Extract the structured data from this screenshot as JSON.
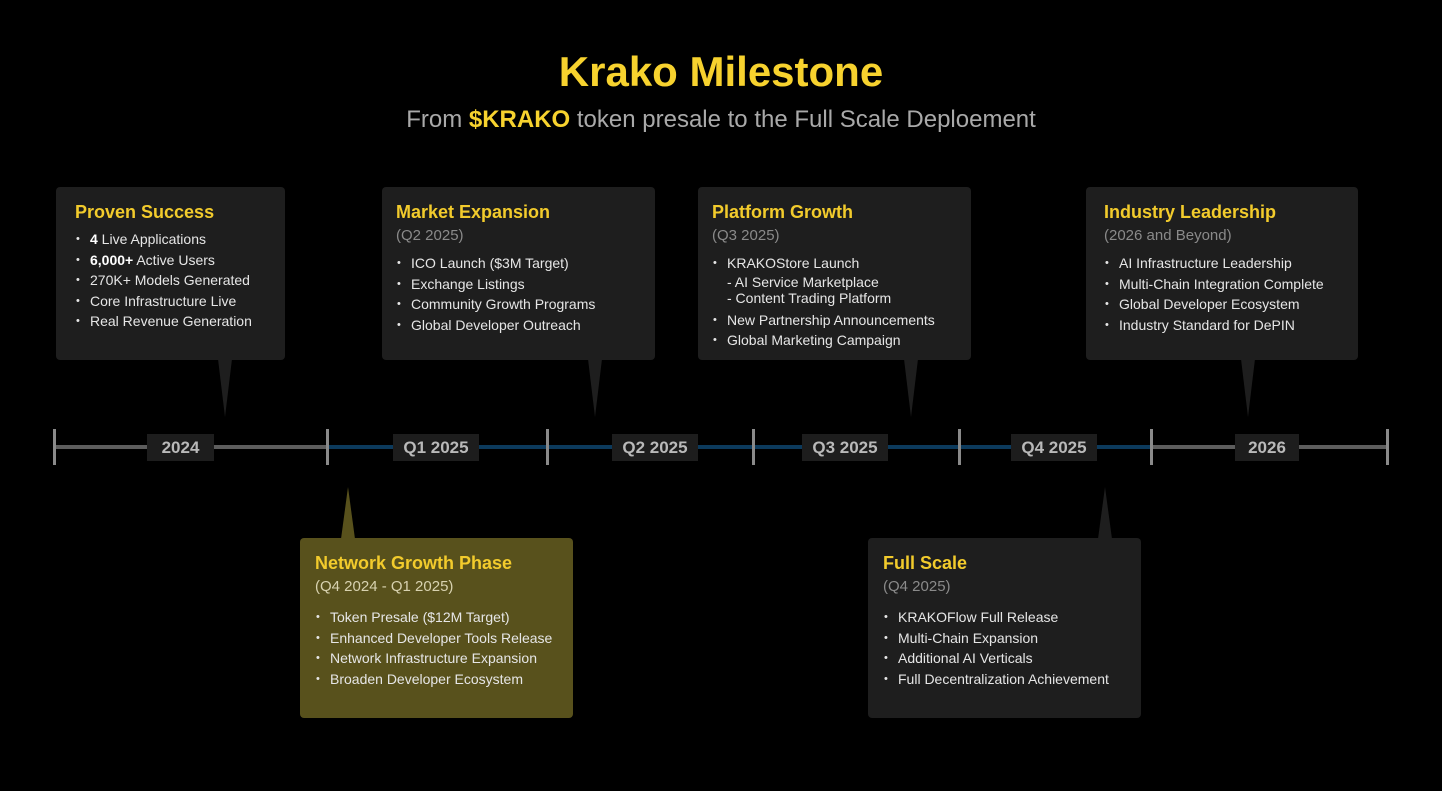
{
  "header": {
    "title": "Krako Milestone",
    "subtitle_pre": "From ",
    "subtitle_highlight": "$KRAKO",
    "subtitle_post": " token presale to the Full Scale Deploement"
  },
  "timeline": {
    "periods": [
      "2024",
      "Q1 2025",
      "Q2 2025",
      "Q3 2025",
      "Q4 2025",
      "2026"
    ]
  },
  "milestones": {
    "proven_success": {
      "title": "Proven Success",
      "items": [
        {
          "bold": "4",
          "text": " Live Applications"
        },
        {
          "bold": "6,000+",
          "text": " Active Users"
        },
        {
          "text": "270K+ Models Generated"
        },
        {
          "text": "Core Infrastructure Live"
        },
        {
          "text": "Real Revenue Generation"
        }
      ]
    },
    "market_expansion": {
      "title": "Market Expansion",
      "period": "(Q2 2025)",
      "items": [
        "ICO Launch ($3M Target)",
        "Exchange Listings",
        "Community Growth Programs",
        "Global Developer Outreach"
      ]
    },
    "platform_growth": {
      "title": "Platform Growth",
      "period": "(Q3 2025)",
      "item1": "KRAKOStore Launch",
      "item1_sub1": "- AI Service Marketplace",
      "item1_sub2": "- Content Trading Platform",
      "items": [
        "New Partnership Announcements",
        "Global Marketing Campaign"
      ]
    },
    "industry_leadership": {
      "title": "Industry Leadership",
      "period": "(2026 and Beyond)",
      "items": [
        "AI Infrastructure Leadership",
        "Multi-Chain Integration Complete",
        "Global Developer Ecosystem",
        "Industry Standard for DePIN"
      ]
    },
    "network_growth": {
      "title": "Network Growth Phase",
      "period": "(Q4 2024 - Q1 2025)",
      "items": [
        "Token Presale ($12M Target)",
        "Enhanced Developer Tools Release",
        "Network Infrastructure Expansion",
        "Broaden Developer Ecosystem"
      ]
    },
    "full_scale": {
      "title": "Full Scale",
      "period": "(Q4 2025)",
      "items": [
        "KRAKOFlow Full Release",
        "Multi-Chain Expansion",
        "Additional AI Verticals",
        "Full Decentralization Achievement"
      ]
    }
  },
  "colors": {
    "accent": "#f7d22e",
    "card_bg": "#1e1e1e",
    "highlight_card_bg": "#58511c",
    "timeline_blue": "#0c3a5c",
    "timeline_grey": "#5d5d5d"
  }
}
